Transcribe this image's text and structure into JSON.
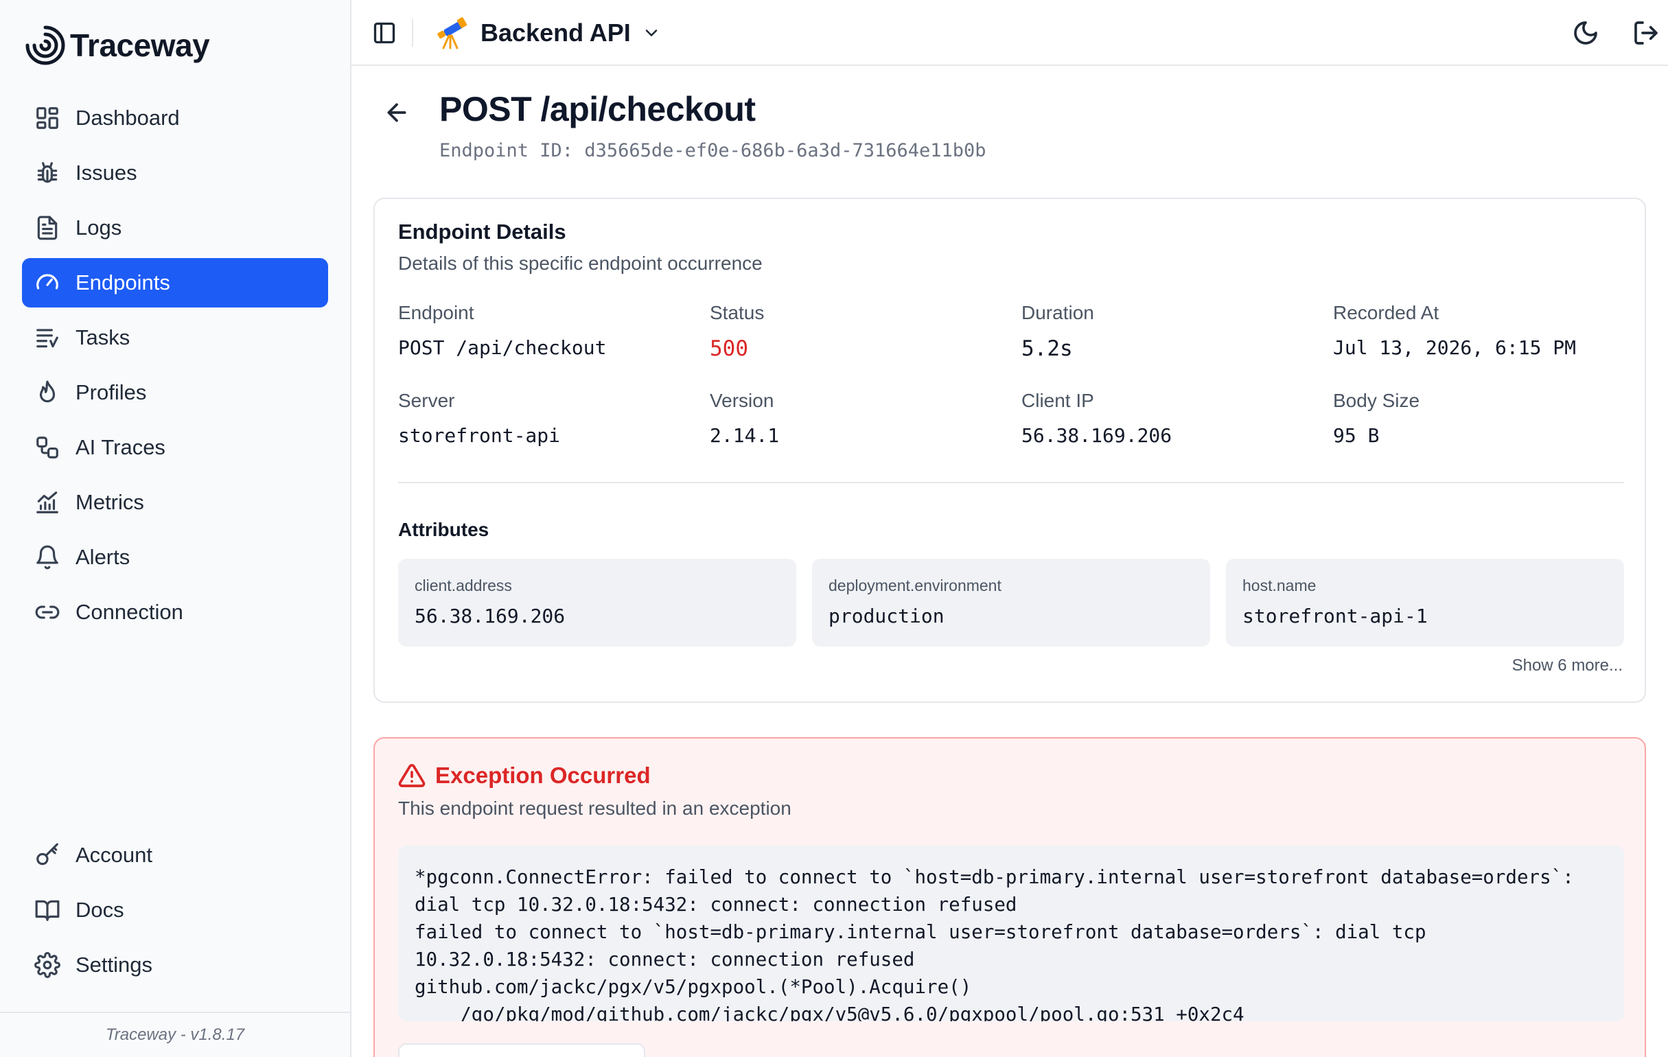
{
  "app": {
    "name": "Traceway",
    "version_footer": "Traceway - v1.8.17"
  },
  "sidebar": {
    "items": [
      {
        "label": "Dashboard",
        "icon": "dashboard-icon"
      },
      {
        "label": "Issues",
        "icon": "bug-icon"
      },
      {
        "label": "Logs",
        "icon": "file-text-icon"
      },
      {
        "label": "Endpoints",
        "icon": "gauge-icon",
        "active": true
      },
      {
        "label": "Tasks",
        "icon": "list-tasks-icon"
      },
      {
        "label": "Profiles",
        "icon": "flame-icon"
      },
      {
        "label": "AI Traces",
        "icon": "workflow-icon"
      },
      {
        "label": "Metrics",
        "icon": "bar-chart-icon"
      },
      {
        "label": "Alerts",
        "icon": "bell-icon"
      },
      {
        "label": "Connection",
        "icon": "link-icon"
      }
    ],
    "bottom_items": [
      {
        "label": "Account",
        "icon": "key-icon"
      },
      {
        "label": "Docs",
        "icon": "book-icon"
      },
      {
        "label": "Settings",
        "icon": "gear-icon"
      }
    ],
    "active_color": "#1d5cf5"
  },
  "topbar": {
    "project_name": "Backend API"
  },
  "page": {
    "title": "POST /api/checkout",
    "subtitle": "Endpoint ID: d35665de-ef0e-686b-6a3d-731664e11b0b"
  },
  "details": {
    "title": "Endpoint Details",
    "description": "Details of this specific endpoint occurrence",
    "fields": {
      "endpoint": {
        "label": "Endpoint",
        "value": "POST /api/checkout"
      },
      "status": {
        "label": "Status",
        "value": "500"
      },
      "duration": {
        "label": "Duration",
        "value": "5.2s"
      },
      "recorded_at": {
        "label": "Recorded At",
        "value": "Jul 13, 2026, 6:15 PM"
      },
      "server": {
        "label": "Server",
        "value": "storefront-api"
      },
      "version": {
        "label": "Version",
        "value": "2.14.1"
      },
      "client_ip": {
        "label": "Client IP",
        "value": "56.38.169.206"
      },
      "body_size": {
        "label": "Body Size",
        "value": "95 B"
      }
    },
    "attributes_title": "Attributes",
    "attributes": [
      {
        "key": "client.address",
        "value": "56.38.169.206"
      },
      {
        "key": "deployment.environment",
        "value": "production"
      },
      {
        "key": "host.name",
        "value": "storefront-api-1"
      }
    ],
    "show_more": "Show 6 more...",
    "status_color": "#dc2626"
  },
  "exception": {
    "title": "Exception Occurred",
    "description": "This endpoint request resulted in an exception",
    "trace": "*pgconn.ConnectError: failed to connect to `host=db-primary.internal user=storefront database=orders`:\ndial tcp 10.32.0.18:5432: connect: connection refused\nfailed to connect to `host=db-primary.internal user=storefront database=orders`: dial tcp\n10.32.0.18:5432: connect: connection refused\ngithub.com/jackc/pgx/v5/pgxpool.(*Pool).Acquire()\n    /go/pkg/mod/github.com/jackc/pgx/v5@v5.6.0/pgxpool/pool.go:531 +0x2c4",
    "accent_color": "#dc2626"
  }
}
